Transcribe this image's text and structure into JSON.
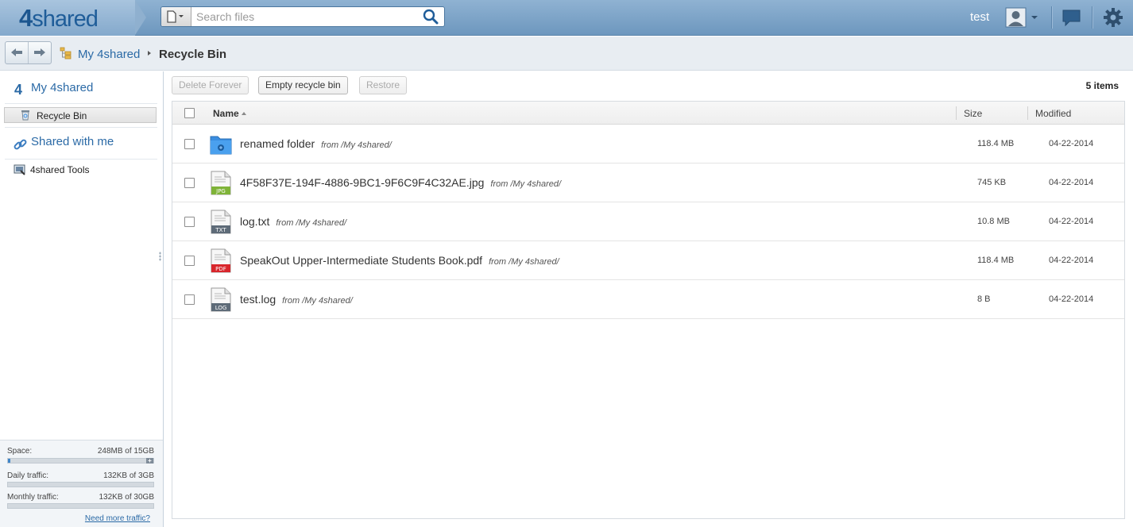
{
  "brand": {
    "logo_num": "4",
    "logo_text": "shared"
  },
  "search": {
    "placeholder": "Search files"
  },
  "user": {
    "name": "test"
  },
  "breadcrumb": {
    "root": "My 4shared",
    "current": "Recycle Bin"
  },
  "sidebar": {
    "my": "My 4shared",
    "recycle": "Recycle Bin",
    "shared": "Shared with me",
    "tools": "4shared Tools"
  },
  "quota": {
    "space_label": "Space:",
    "space_value": "248MB of 15GB",
    "space_fraction": 0.016,
    "daily_label": "Daily traffic:",
    "daily_value": "132KB of 3GB",
    "daily_fraction": 0.0,
    "monthly_label": "Monthly traffic:",
    "monthly_value": "132KB of 30GB",
    "monthly_fraction": 0.0,
    "need_more": "Need more traffic?"
  },
  "toolbar": {
    "delete_forever": "Delete Forever",
    "empty_bin": "Empty recycle bin",
    "restore": "Restore",
    "item_count": "5 items"
  },
  "table": {
    "col_name": "Name",
    "col_size": "Size",
    "col_modified": "Modified",
    "rows": [
      {
        "name": "renamed folder",
        "from": "from /My 4shared/",
        "size": "118.4 MB",
        "modified": "04-22-2014",
        "icon": "folder-icon"
      },
      {
        "name": "4F58F37E-194F-4886-9BC1-9F6C9F4C32AE.jpg",
        "from": "from /My 4shared/",
        "size": "745 KB",
        "modified": "04-22-2014",
        "icon": "jpg-file-icon",
        "badge": "JPG"
      },
      {
        "name": "log.txt",
        "from": "from /My 4shared/",
        "size": "10.8 MB",
        "modified": "04-22-2014",
        "icon": "txt-file-icon",
        "badge": "TXT"
      },
      {
        "name": "SpeakOut Upper-Intermediate Students Book.pdf",
        "from": "from /My 4shared/",
        "size": "118.4 MB",
        "modified": "04-22-2014",
        "icon": "pdf-file-icon",
        "badge": "PDF"
      },
      {
        "name": "test.log",
        "from": "from /My 4shared/",
        "size": "8 B",
        "modified": "04-22-2014",
        "icon": "log-file-icon",
        "badge": "LOG"
      }
    ]
  },
  "colors": {
    "accent": "#2b6aa6",
    "topbar": "#7ea4c8",
    "pdf": "#d8262c",
    "jpg": "#7fb338",
    "doc": "#5e6b78",
    "folder": "#3a8de0"
  }
}
